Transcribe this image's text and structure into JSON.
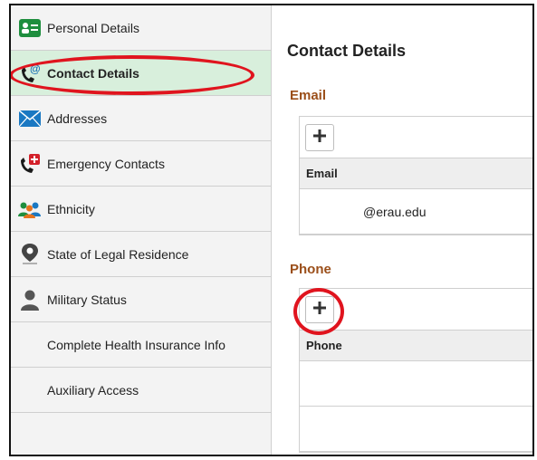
{
  "sidebar": {
    "items": [
      {
        "label": "Personal Details",
        "icon": "id-card-icon"
      },
      {
        "label": "Contact Details",
        "icon": "phone-at-icon",
        "active": true
      },
      {
        "label": "Addresses",
        "icon": "envelope-icon"
      },
      {
        "label": "Emergency Contacts",
        "icon": "phone-plus-icon"
      },
      {
        "label": "Ethnicity",
        "icon": "people-icon"
      },
      {
        "label": "State of Legal Residence",
        "icon": "map-pin-icon"
      },
      {
        "label": "Military Status",
        "icon": "person-icon"
      },
      {
        "label": "Complete Health Insurance Info",
        "icon": ""
      },
      {
        "label": "Auxiliary Access",
        "icon": ""
      }
    ]
  },
  "main": {
    "title": "Contact Details",
    "email_section": {
      "title": "Email",
      "header": "Email",
      "rows": [
        "@erau.edu"
      ]
    },
    "phone_section": {
      "title": "Phone",
      "header": "Phone",
      "rows": [
        "",
        ""
      ]
    }
  },
  "colors": {
    "accent_green": "#1e8e3e",
    "active_bg": "#d8efdc",
    "section_title": "#9b4f1a",
    "highlight_red": "#e0141e"
  }
}
